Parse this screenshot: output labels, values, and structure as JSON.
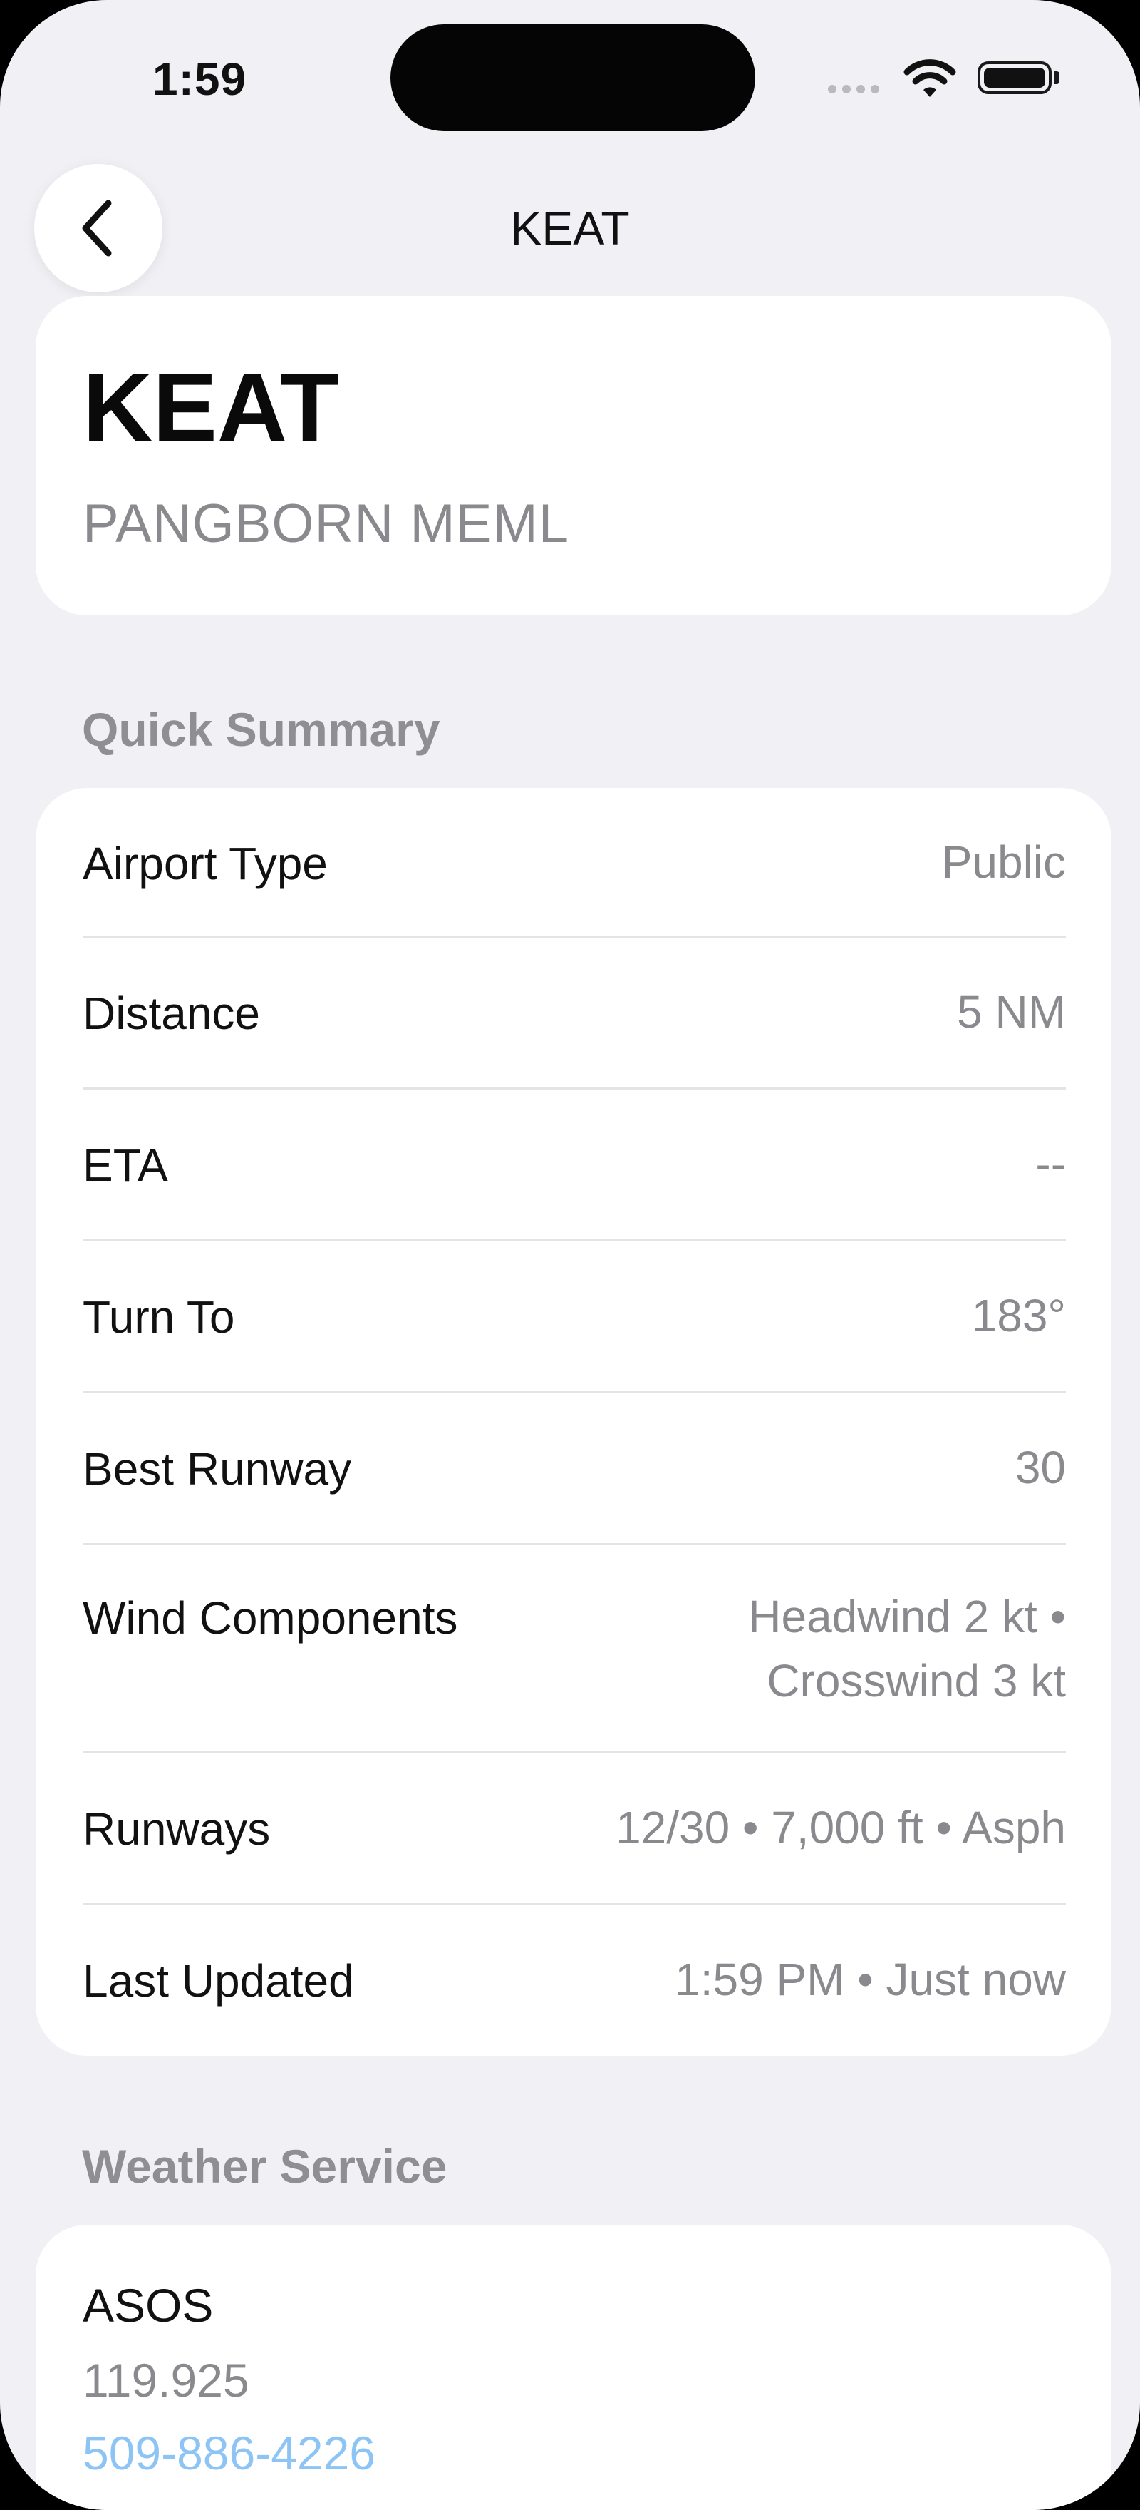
{
  "status_bar": {
    "time": "1:59"
  },
  "nav": {
    "title": "KEAT"
  },
  "airport": {
    "code": "KEAT",
    "name": "PANGBORN MEML"
  },
  "quick_summary": {
    "heading": "Quick Summary",
    "rows": [
      {
        "label": "Airport Type",
        "value": "Public"
      },
      {
        "label": "Distance",
        "value": "5 NM"
      },
      {
        "label": "ETA",
        "value": "--"
      },
      {
        "label": "Turn To",
        "value": "183°"
      },
      {
        "label": "Best Runway",
        "value": "30"
      },
      {
        "label": "Wind Components",
        "value_line1": "Headwind 2 kt •",
        "value_line2": "Crosswind 3 kt"
      },
      {
        "label": "Runways",
        "value": "12/30 • 7,000 ft • Asph"
      },
      {
        "label": "Last Updated",
        "value": "1:59 PM • Just now"
      }
    ]
  },
  "weather_service": {
    "heading": "Weather Service",
    "name": "ASOS",
    "frequency": "119.925",
    "phone": "509-886-4226"
  }
}
